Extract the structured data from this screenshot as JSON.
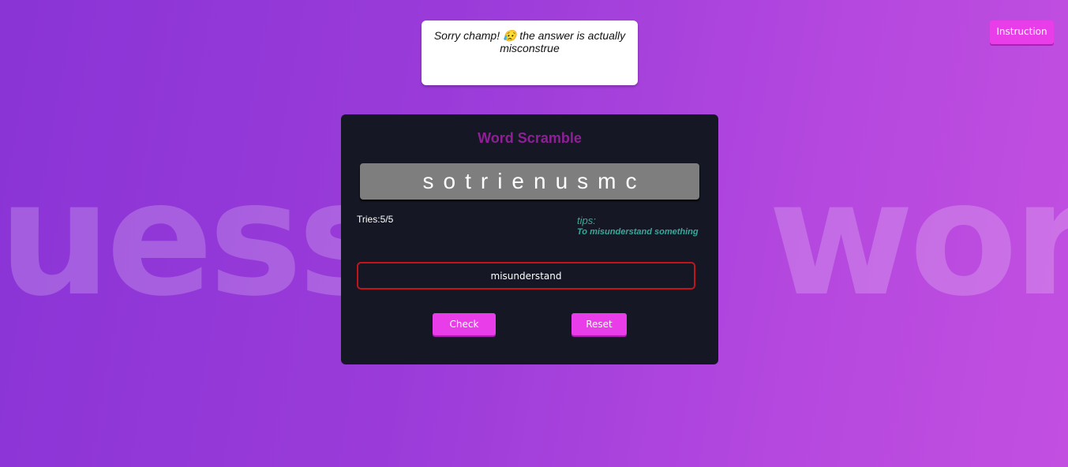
{
  "background": {
    "watermark_text": "Guess the word"
  },
  "message": {
    "text_before_emoji": "Sorry champ! ",
    "emoji": "😥",
    "text_after_emoji": " the answer is actually misconstrue"
  },
  "header": {
    "instruction_label": "Instruction"
  },
  "game": {
    "title": "Word Scramble",
    "scrambled_word": "sotrienusmc",
    "tries_label": "Tries:",
    "tries_value": "5/5",
    "tips_label": "tips:",
    "tips_text": "To misunderstand something",
    "input_value": "misunderstand",
    "input_placeholder": "",
    "check_label": "Check",
    "reset_label": "Reset"
  },
  "colors": {
    "accent": "#e83de8",
    "title": "#8f1f97",
    "tips": "#39a89a",
    "card_bg": "#151824",
    "error_border": "#c4141a"
  }
}
